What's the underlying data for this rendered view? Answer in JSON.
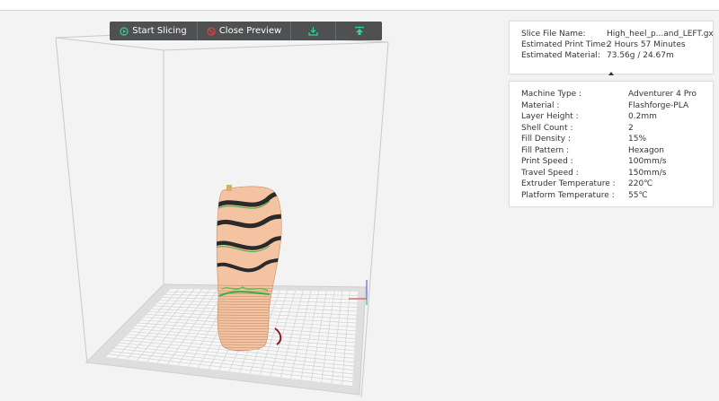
{
  "toolbar": {
    "start_slicing": "Start Slicing",
    "close_preview": "Close Preview",
    "icons": [
      "play-circle-icon",
      "no-entry-icon",
      "download-icon",
      "upload-to-printer-icon"
    ],
    "accent": "#2fd49a",
    "warn": "#e2463f"
  },
  "summary": {
    "rows": [
      {
        "label": "Slice File Name:",
        "value": "High_heel_p...and_LEFT.gx"
      },
      {
        "label": "Estimated Print Time:",
        "value": "2 Hours 57 Minutes"
      },
      {
        "label": "Estimated Material:",
        "value": "73.56g / 24.67m"
      }
    ]
  },
  "details": {
    "rows": [
      {
        "label": "Machine Type :",
        "value": "Adventurer 4 Pro"
      },
      {
        "label": "Material :",
        "value": "Flashforge-PLA"
      },
      {
        "label": "Layer Height :",
        "value": "0.2mm"
      },
      {
        "label": "Shell Count :",
        "value": "2"
      },
      {
        "label": "Fill Density :",
        "value": "15%"
      },
      {
        "label": "Fill Pattern :",
        "value": "Hexagon"
      },
      {
        "label": "Print Speed :",
        "value": "100mm/s"
      },
      {
        "label": "Travel Speed :",
        "value": "150mm/s"
      },
      {
        "label": "Extruder Temperature :",
        "value": "220℃"
      },
      {
        "label": "Platform Temperature :",
        "value": "55℃"
      }
    ]
  },
  "colors": {
    "model": "#f3c2a0",
    "model_stripe": "#2b2b2b",
    "model_green": "#3cae43",
    "bed": "#dcdcdc"
  }
}
